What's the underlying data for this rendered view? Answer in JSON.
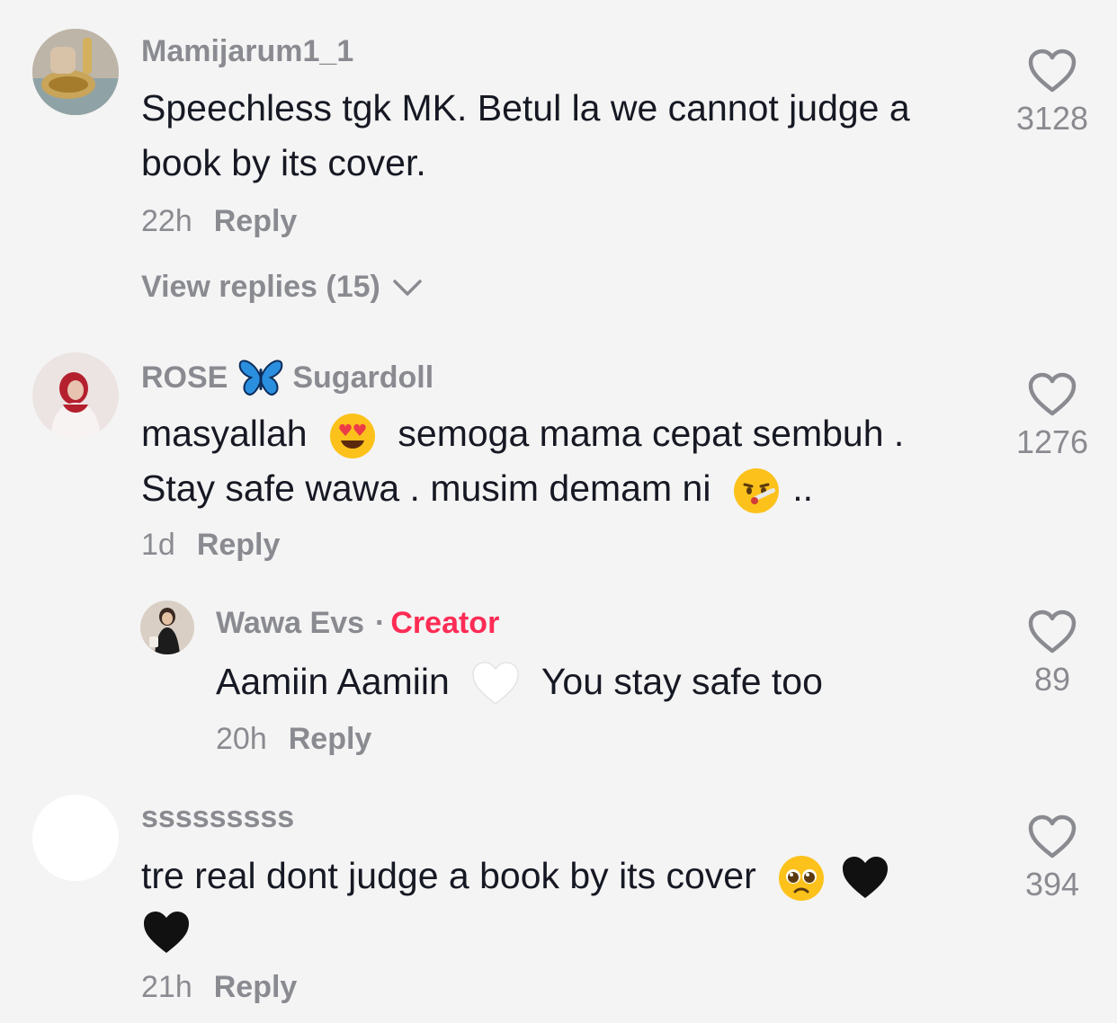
{
  "comments": [
    {
      "username": "Mamijarum1_1",
      "text_line1": "Speechless tgk MK. Betul la we cannot judge a",
      "text_line2": "book by its cover.",
      "time": "22h",
      "reply_label": "Reply",
      "view_replies": "View replies (15)",
      "likes": "3128"
    },
    {
      "username_part1": "ROSE",
      "username_part2": "Sugardoll",
      "text_line1a": "masyallah",
      "text_line1b": "semoga mama cepat sembuh .",
      "text_line2a": "Stay safe wawa . musim demam ni",
      "text_line2b": "..",
      "time": "1d",
      "reply_label": "Reply",
      "likes": "1276"
    },
    {
      "username": "Wawa Evs",
      "separator": "·",
      "badge": "Creator",
      "text_a": "Aamiin Aamiin",
      "text_b": "You stay safe too",
      "time": "20h",
      "reply_label": "Reply",
      "likes": "89"
    },
    {
      "username": "sssssssss",
      "text_line1": "tre real dont judge a book by its cover",
      "time": "21h",
      "reply_label": "Reply",
      "likes": "394"
    }
  ],
  "colors": {
    "background": "#f4f4f4",
    "secondary_text": "#8a8b91",
    "creator_badge": "#fe2c55"
  },
  "icons": [
    "heart-outline-icon",
    "chevron-down-icon",
    "butterfly-emoji",
    "heart-eyes-emoji",
    "thermometer-face-emoji",
    "white-heart-emoji",
    "pleading-face-emoji",
    "black-heart-emoji"
  ]
}
